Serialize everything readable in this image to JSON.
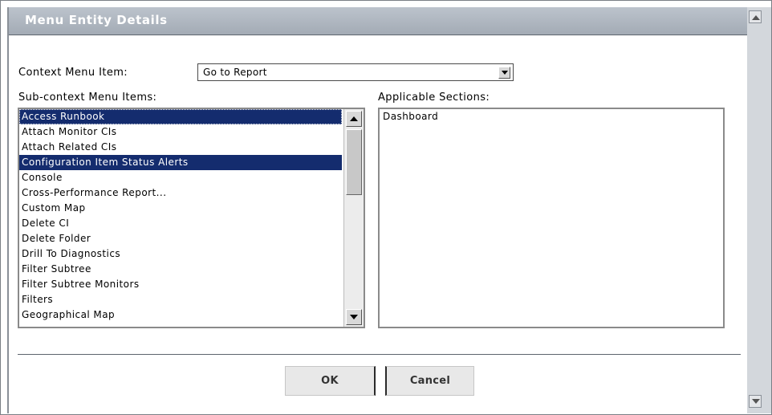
{
  "dialog": {
    "title": "Menu Entity Details"
  },
  "context_menu": {
    "label": "Context Menu Item:",
    "selected_value": "Go to Report"
  },
  "sub_context": {
    "label": "Sub-context Menu Items:",
    "items": [
      {
        "label": "Access Runbook",
        "selected": true,
        "focused": true
      },
      {
        "label": "Attach Monitor CIs",
        "selected": false
      },
      {
        "label": "Attach Related CIs",
        "selected": false
      },
      {
        "label": "Configuration Item Status Alerts",
        "selected": true
      },
      {
        "label": "Console",
        "selected": false
      },
      {
        "label": "Cross-Performance Report...",
        "selected": false
      },
      {
        "label": "Custom Map",
        "selected": false
      },
      {
        "label": "Delete CI",
        "selected": false
      },
      {
        "label": "Delete Folder",
        "selected": false
      },
      {
        "label": "Drill To Diagnostics",
        "selected": false
      },
      {
        "label": "Filter Subtree",
        "selected": false
      },
      {
        "label": "Filter Subtree Monitors",
        "selected": false
      },
      {
        "label": "Filters",
        "selected": false
      },
      {
        "label": "Geographical Map",
        "selected": false
      }
    ]
  },
  "applicable_sections": {
    "label": "Applicable Sections:",
    "items": [
      "Dashboard"
    ]
  },
  "buttons": {
    "ok": "OK",
    "cancel": "Cancel"
  },
  "colors": {
    "selection": "#142c6e",
    "title_bar": "#aeb5be",
    "divider": "#5d646d"
  }
}
